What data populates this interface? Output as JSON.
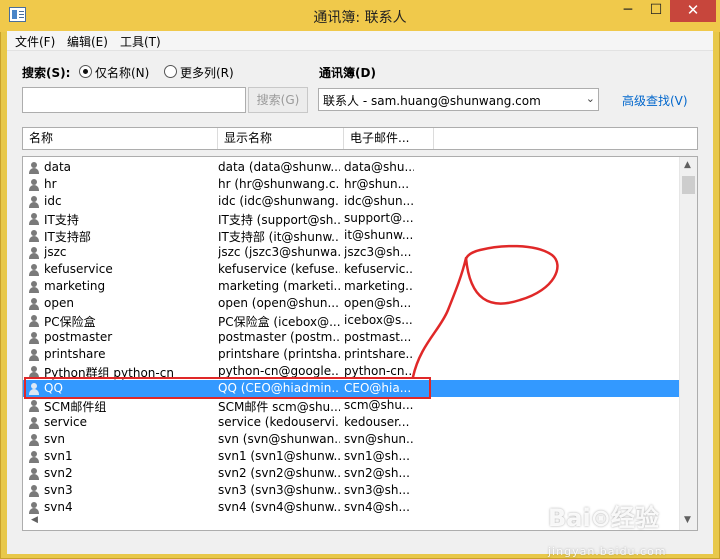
{
  "window": {
    "title": "通讯簿: 联系人",
    "min": "─",
    "max": "☐",
    "close": "✕"
  },
  "menu": [
    {
      "label": "文件(F)"
    },
    {
      "label": "编辑(E)"
    },
    {
      "label": "工具(T)"
    }
  ],
  "search": {
    "label": "搜索(S):",
    "option_name_only": "仅名称(N)",
    "option_more_columns": "更多列(R)",
    "selected_option": "name_only",
    "input_value": "",
    "button_label": "搜索(G)"
  },
  "addressbook": {
    "label": "通讯簿(D)",
    "selected": "联系人 - sam.huang@shunwang.com",
    "advanced_link": "高级查找(V)"
  },
  "columns": {
    "name": "名称",
    "display_name": "显示名称",
    "email": "电子邮件..."
  },
  "rows": [
    {
      "name": "data",
      "display": "data (data@shunw...",
      "email": "data@shu..."
    },
    {
      "name": "hr",
      "display": "hr (hr@shunwang.c...",
      "email": "hr@shun..."
    },
    {
      "name": "idc",
      "display": "idc (idc@shunwang...",
      "email": "idc@shun..."
    },
    {
      "name": "IT支持",
      "display": "IT支持 (support@sh...",
      "email": "support@..."
    },
    {
      "name": "IT支持部",
      "display": "IT支持部 (it@shunw...",
      "email": "it@shunw..."
    },
    {
      "name": "jszc",
      "display": "jszc (jszc3@shunwa...",
      "email": "jszc3@sh..."
    },
    {
      "name": "kefuservice",
      "display": "kefuservice (kefuse...",
      "email": "kefuservic..."
    },
    {
      "name": "marketing",
      "display": "marketing (marketi...",
      "email": "marketing..."
    },
    {
      "name": "open",
      "display": "open (open@shun...",
      "email": "open@sh..."
    },
    {
      "name": "PC保险盒",
      "display": "PC保险盒 (icebox@...",
      "email": "icebox@s..."
    },
    {
      "name": "postmaster",
      "display": "postmaster (postm...",
      "email": "postmast..."
    },
    {
      "name": "printshare",
      "display": "printshare (printsha...",
      "email": "printshare..."
    },
    {
      "name": "Python群组 python-cn",
      "display": "python-cn@google...",
      "email": "python-cn..."
    },
    {
      "name": "QQ",
      "display": "QQ (CEO@hiadmin....",
      "email": "CEO@hia...",
      "selected": true
    },
    {
      "name": "SCM邮件组",
      "display": "SCM邮件 scm@shu...",
      "email": "scm@shu..."
    },
    {
      "name": "service",
      "display": "service (kedouservi...",
      "email": "kedouser..."
    },
    {
      "name": "svn",
      "display": "svn (svn@shunwan...",
      "email": "svn@shun..."
    },
    {
      "name": "svn1",
      "display": "svn1 (svn1@shunw...",
      "email": "svn1@sh..."
    },
    {
      "name": "svn2",
      "display": "svn2 (svn2@shunw...",
      "email": "svn2@sh..."
    },
    {
      "name": "svn3",
      "display": "svn3 (svn3@shunw...",
      "email": "svn3@sh..."
    },
    {
      "name": "svn4",
      "display": "svn4 (svn4@shunw...",
      "email": "svn4@sh..."
    }
  ],
  "scroll": {
    "up": "▲",
    "down": "▼",
    "left": "◀"
  },
  "colors": {
    "selection": "#3399ff",
    "annotation_red": "#e02828",
    "title_bar": "#f0c94b",
    "link_blue": "#0066cc"
  },
  "watermark": {
    "text": "Bai⊙经验",
    "sub": "jingyan.baidu.com"
  }
}
